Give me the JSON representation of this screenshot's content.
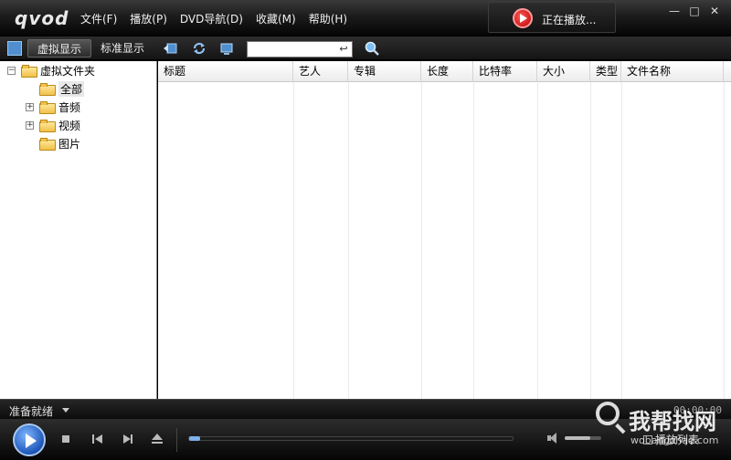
{
  "app": {
    "logo": "qvod"
  },
  "menu": [
    {
      "label": "文件(F)"
    },
    {
      "label": "播放(P)"
    },
    {
      "label": "DVD导航(D)"
    },
    {
      "label": "收藏(M)"
    },
    {
      "label": "帮助(H)"
    }
  ],
  "now_playing": {
    "label": "正在播放..."
  },
  "toolbar": {
    "tab_virtual": "虚拟显示",
    "tab_standard": "标准显示",
    "search_value": ""
  },
  "tree": {
    "root": "虚拟文件夹",
    "items": [
      {
        "label": "全部"
      },
      {
        "label": "音频"
      },
      {
        "label": "视频"
      },
      {
        "label": "图片"
      }
    ]
  },
  "list": {
    "columns": [
      {
        "label": "标题"
      },
      {
        "label": "艺人"
      },
      {
        "label": "专辑"
      },
      {
        "label": "长度"
      },
      {
        "label": "比特率"
      },
      {
        "label": "大小"
      },
      {
        "label": "类型"
      },
      {
        "label": "文件名称"
      }
    ]
  },
  "status": {
    "text": "准备就绪",
    "time": "00:00:00"
  },
  "controls": {
    "playlist_label": "播放列表",
    "seek_progress": 0.0,
    "volume": 0.7
  },
  "watermark": {
    "text": "我帮找网",
    "url": "wobangzhao.com"
  },
  "colors": {
    "accent": "#2e6fd0",
    "chrome": "#1c1c1c"
  }
}
